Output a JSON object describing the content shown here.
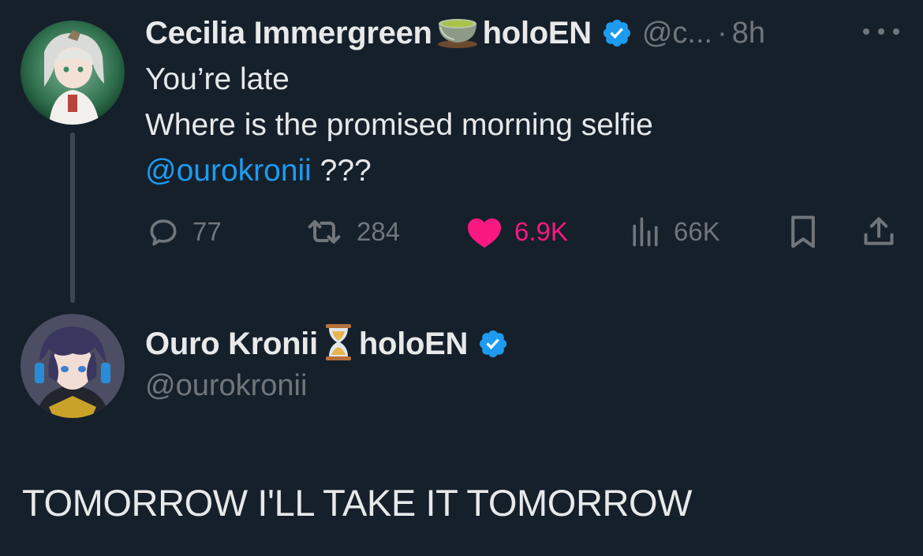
{
  "tweet": {
    "author_name": "Cecilia Immergreen",
    "author_suffix": "holoEN",
    "author_emoji": "tea-cup",
    "handle": "@c...",
    "separator": "·",
    "time": "8h",
    "lines": [
      "You’re late",
      "Where is the promised morning selfie"
    ],
    "mention": "@ourokronii",
    "mention_suffix": " ???",
    "replies": "77",
    "reposts": "284",
    "likes": "6.9K",
    "views": "66K",
    "liked": true
  },
  "reply": {
    "author_name": "Ouro Kronii",
    "author_suffix": "holoEN",
    "author_emoji": "hourglass",
    "handle": "@ourokronii",
    "text": "TOMORROW I'LL TAKE IT TOMORROW"
  },
  "colors": {
    "background": "#16202b",
    "text": "#e7e9ea",
    "muted": "#71767b",
    "link": "#1d9bf0",
    "like": "#f91880",
    "verified": "#1d9bf0"
  }
}
